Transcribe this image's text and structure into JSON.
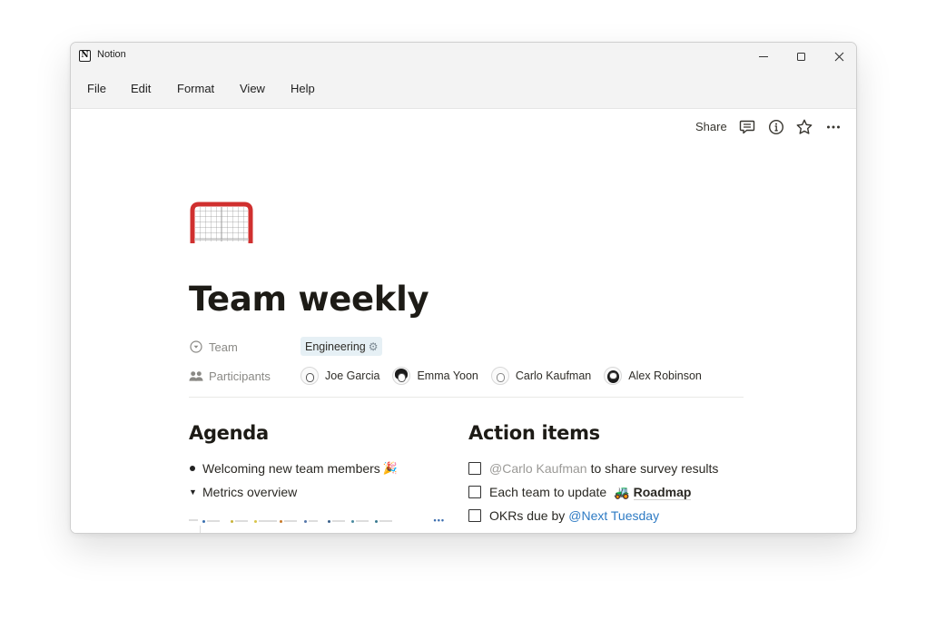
{
  "window": {
    "app_title": "Notion",
    "app_icon": "notion-logo-icon",
    "controls": [
      "minimize-icon",
      "maximize-icon",
      "close-icon"
    ]
  },
  "menubar": {
    "items": [
      "File",
      "Edit",
      "Format",
      "View",
      "Help"
    ]
  },
  "topbar": {
    "share_label": "Share",
    "icons": [
      "comment-icon",
      "info-icon",
      "star-icon",
      "more-icon"
    ]
  },
  "page": {
    "icon": "hockey-goal-icon",
    "title": "Team weekly",
    "properties": {
      "team": {
        "label": "Team",
        "icon": "select-icon",
        "value": "Engineering",
        "value_icon": "gear-icon",
        "tag_color": "#e6f0f5"
      },
      "participants": {
        "label": "Participants",
        "icon": "people-icon",
        "people": [
          {
            "name": "Joe Garcia"
          },
          {
            "name": "Emma Yoon"
          },
          {
            "name": "Carlo Kaufman"
          },
          {
            "name": "Alex Robinson"
          }
        ]
      }
    }
  },
  "agenda": {
    "heading": "Agenda",
    "items": [
      {
        "type": "bullet",
        "text": "Welcoming new team members",
        "emoji": "🎉"
      },
      {
        "type": "toggle",
        "text": "Metrics overview",
        "expanded": true
      }
    ],
    "embed_more": "•••"
  },
  "action_items": {
    "heading": "Action items",
    "items": [
      {
        "checked": false,
        "mention": "@Carlo Kaufman",
        "text": "to share survey results"
      },
      {
        "checked": false,
        "text": "Each team to update",
        "link_emoji": "🚜",
        "link": "Roadmap"
      },
      {
        "checked": false,
        "text": "OKRs due by",
        "date_mention": "@Next Tuesday"
      }
    ]
  },
  "colors": {
    "mention_date": "#2e7bc4",
    "mention_user": "#9b9a97",
    "title": "#1d1b16"
  }
}
